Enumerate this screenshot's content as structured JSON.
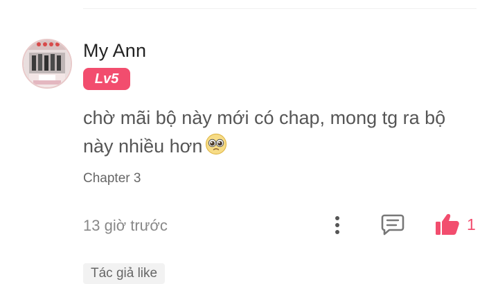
{
  "comment": {
    "username": "My Ann",
    "level": "Lv5",
    "text": "chờ mãi bộ này mới có chap, mong tg ra bộ này nhiều hơn",
    "emoji": "pleading-face-emoji",
    "chapter": "Chapter 3",
    "time": "13 giờ trước",
    "like_count": "1",
    "author_tag": "Tác giả like"
  },
  "colors": {
    "accent": "#f24d6e",
    "text_primary": "#222222",
    "text_body": "#555555",
    "text_muted": "#888888",
    "icon_gray": "#6b6b6b"
  },
  "icons": [
    "more-vertical-icon",
    "comment-reply-icon",
    "thumbs-up-icon"
  ]
}
